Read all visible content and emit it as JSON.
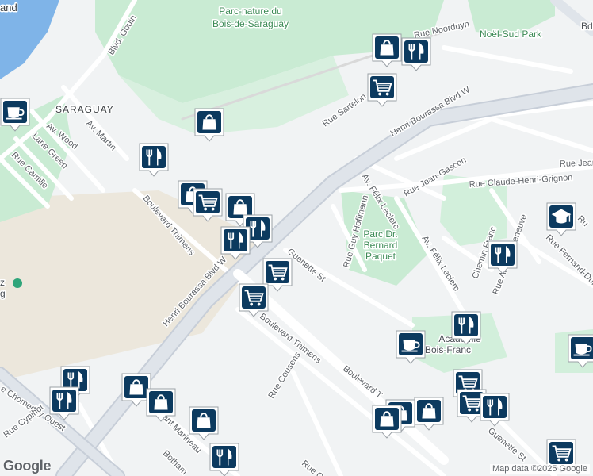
{
  "map": {
    "attribution": "Map data ©2025 Google",
    "logo": "Google",
    "labels": {
      "top_left_fragment": "and",
      "park_saraguay": "Parc-nature du Bois-de-Saraguay",
      "noel_sud_park": "Noël-Sud Park",
      "bd_fragment": "Bd",
      "saraguay": "SARAGUAY",
      "parc_bernard_paquet": "Parc Dr. Bernard Paquet",
      "academie": "Académie Bois-Franc",
      "z_fragment": "z",
      "g_fragment": "g"
    },
    "streets": {
      "blvd_gouin": "Blvd. Gouin",
      "rue_noorduyn": "Rue Noorduyn",
      "rue_sartelon": "Rue Sartelon",
      "henri_bourassa_top": "Henri Bourassa Blvd W",
      "henri_bourassa_bottom": "Henri Bourassa Blvd W",
      "av_wood": "Av. Wood",
      "av_martin": "Av. Martin",
      "lane_green": "Lane Green",
      "rue_camille": "Rue Camille",
      "blvd_thimens_upper": "Boulevard Thimens",
      "blvd_thimens_lower": "Boulevard Thimens",
      "blvd_thimens_right": "Boulevard T",
      "av_felix_leclerc_1": "Av. Félix Leclerc",
      "av_felix_leclerc_2": "Av. Félix Leclerc",
      "rue_jean_gascon": "Rue Jean-Gascon",
      "rue_jean_frag": "Rue Jean",
      "rue_claude_henri_grignon": "Rue Claude-Henri-Grignon",
      "rue_guy_hoffmann": "Rue Guy Hoffmann",
      "guenette_st": "Guenette St",
      "guenette_st_2": "Guenette St",
      "rue_cousens": "Rue Cousens",
      "chomedey_ouest": "e Chomedey Ouest",
      "rue_cypihot": "Rue Cypihot",
      "bant_marineau": "bant Marineau",
      "botham": "Botham",
      "rue_col": "Rue Col",
      "rue_fernand_dum": "Rue Fernand-Dum",
      "rue_arthur_villeneuve": "Rue Arthur-Villeneuve",
      "chem_franc": "Chemin Franc",
      "rue_frag_right": "Ru"
    },
    "pins": [
      {
        "kind": "cafe",
        "icon": "coffee-cup-icon"
      },
      {
        "kind": "shopping",
        "icon": "shopping-bag-icon"
      },
      {
        "kind": "restaurant",
        "icon": "fork-knife-icon"
      },
      {
        "kind": "grocery",
        "icon": "shopping-cart-icon"
      },
      {
        "kind": "school",
        "icon": "graduation-cap-icon"
      }
    ],
    "colors": {
      "park": "#c9ebd3",
      "park_dark": "#a8dab6",
      "water": "#7fb4e8",
      "road": "#ffffff",
      "highway": "#d5dbe3",
      "pin": "#0c3a5f"
    }
  }
}
